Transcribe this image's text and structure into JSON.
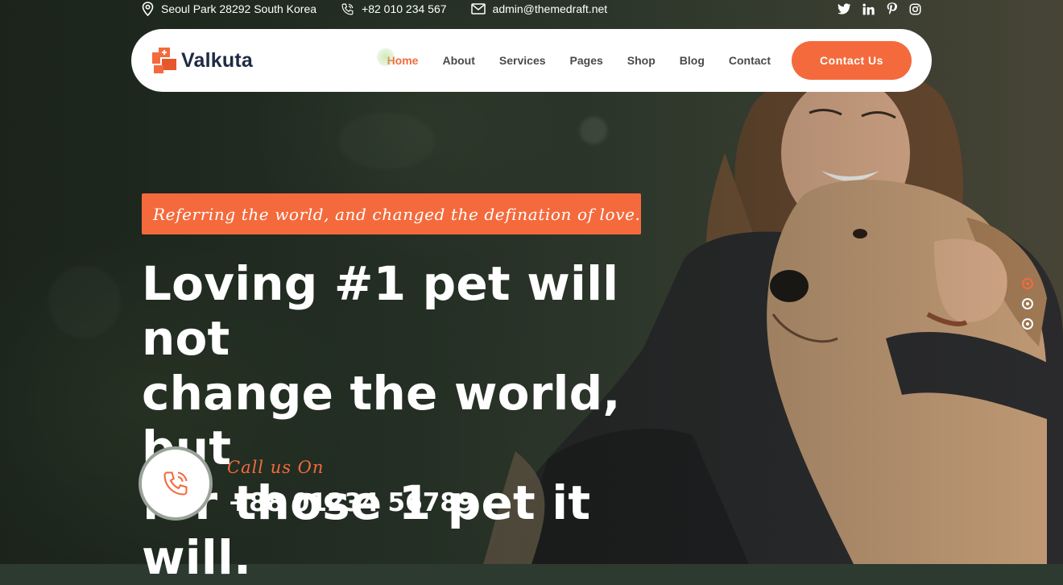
{
  "topbar": {
    "address": "Seoul Park 28292 South Korea",
    "phone": "+82 010 234 567",
    "email": "admin@themedraft.net",
    "icons": [
      "location-icon",
      "phone-icon",
      "mail-icon"
    ],
    "socials": [
      "twitter-icon",
      "linkedin-icon",
      "pinterest-icon",
      "instagram-icon"
    ]
  },
  "brand": {
    "name": "Valkuta",
    "color": "#f46a3c"
  },
  "nav": {
    "items": [
      "Home",
      "About",
      "Services",
      "Pages",
      "Shop",
      "Blog",
      "Contact"
    ],
    "active": "Home",
    "cta": "Contact Us"
  },
  "hero": {
    "tagline": "Referring the world, and changed the defination of love.",
    "headline_lines": [
      "Loving #1 pet will not",
      "change the world, but",
      "for those 1 pet it will."
    ],
    "call_label": "Call us On",
    "phone": "+88 01234 56789"
  },
  "slider": {
    "count": 3,
    "active_index": 0
  },
  "colors": {
    "accent": "#f46a3c",
    "navy": "#1f2a44",
    "white": "#ffffff"
  }
}
